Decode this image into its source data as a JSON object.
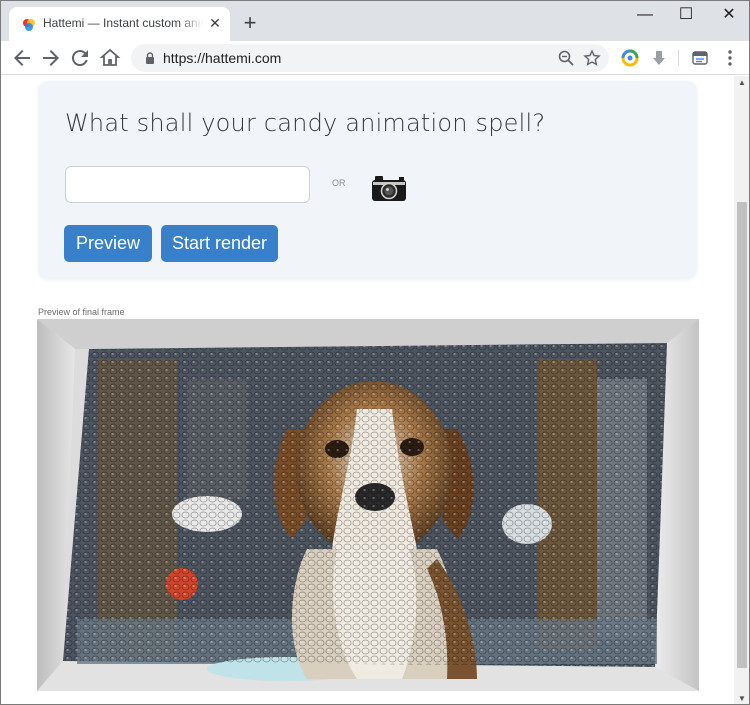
{
  "browser": {
    "tab_title": "Hattemi — Instant custom animations",
    "tab_close": "✕",
    "new_tab": "+",
    "url": "https://hattemi.com",
    "window_controls": {
      "minimize": "—",
      "maximize": "☐",
      "close": "✕"
    }
  },
  "card": {
    "title": "What shall your candy animation spell?",
    "input_value": "",
    "input_placeholder": "",
    "or_label": "OR",
    "preview_button": "Preview",
    "render_button": "Start render"
  },
  "preview": {
    "label": "Preview of final frame"
  },
  "colors": {
    "button": "#3880c9",
    "card_bg": "#f1f5f9",
    "tabstrip_bg": "#dee1e6"
  }
}
